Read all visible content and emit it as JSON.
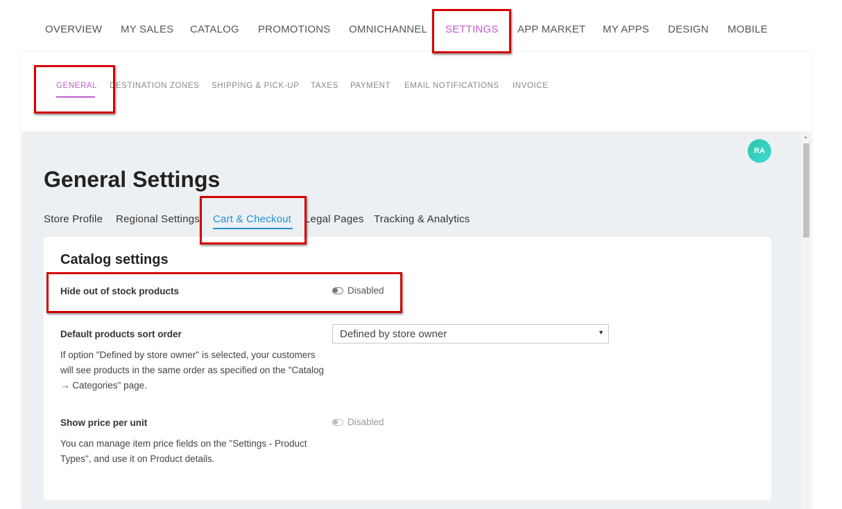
{
  "top_nav": {
    "items": [
      "OVERVIEW",
      "MY SALES",
      "CATALOG",
      "PROMOTIONS",
      "OMNICHANNEL",
      "SETTINGS",
      "APP MARKET",
      "MY APPS",
      "DESIGN",
      "MOBILE"
    ],
    "active": "SETTINGS"
  },
  "sub_nav": {
    "items": [
      "GENERAL",
      "DESTINATION ZONES",
      "SHIPPING & PICK-UP",
      "TAXES",
      "PAYMENT",
      "EMAIL NOTIFICATIONS",
      "INVOICE"
    ],
    "active": "GENERAL"
  },
  "avatar": {
    "initials": "RA"
  },
  "page_title": "General Settings",
  "tabs": {
    "items": [
      "Store Profile",
      "Regional Settings",
      "Cart & Checkout",
      "Legal Pages",
      "Tracking & Analytics"
    ],
    "active": "Cart & Checkout"
  },
  "catalog_settings": {
    "heading": "Catalog settings",
    "hide_out_of_stock": {
      "label": "Hide out of stock products",
      "status": "Disabled"
    },
    "sort_order": {
      "label": "Default products sort order",
      "description": "If option \"Defined by store owner\" is selected, your customers will see products in the same order as specified on the \"Catalog → Categories\" page.",
      "selected": "Defined by store owner"
    },
    "price_per_unit": {
      "label": "Show price per unit",
      "description": "You can manage item price fields on the \"Settings - Product Types\", and use it on Product details.",
      "status": "Disabled"
    }
  },
  "colors": {
    "active_nav": "#c25ccf",
    "active_tab": "#1e8fd6",
    "highlight": "#d40000",
    "avatar": "#2bc6a8"
  }
}
